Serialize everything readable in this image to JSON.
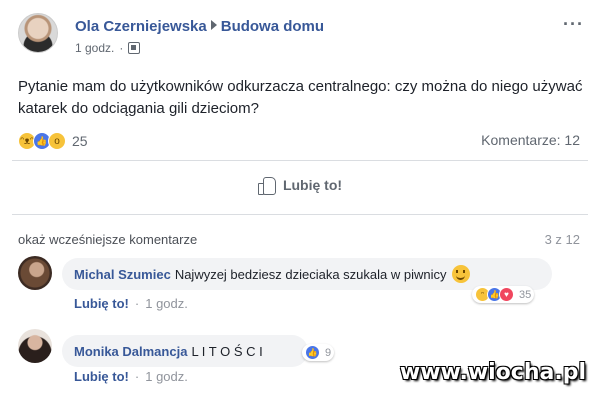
{
  "post": {
    "author": "Ola Czerniejewska",
    "group": "Budowa domu",
    "time": "1 godz.",
    "text": "Pytanie mam do użytkowników odkurzacza centralnego: czy można do niego używać katarek do odciągania gili dzieciom?",
    "reaction_count": "25",
    "comments_label": "Komentarze: 12",
    "like_action": "Lubię to!"
  },
  "comments_section": {
    "previous_label": "okaż wcześniejsze komentarze",
    "page_count": "3 z 12",
    "comments": [
      {
        "author": "Michal Szumiec",
        "text": "Najwyzej bedziesz dzieciaka szukala w piwnicy",
        "like_label": "Lubię to!",
        "separator": "·",
        "time": "1 godz.",
        "reaction_count": "35"
      },
      {
        "author": "Monika Dalmancja",
        "text": "L I T O Ś C I",
        "like_label": "Lubię to!",
        "separator": "·",
        "time": "1 godz.",
        "reaction_count": "9"
      }
    ]
  },
  "watermark": "www.wiocha.pl",
  "colors": {
    "link": "#385898",
    "text": "#1d2129",
    "muted": "#606770",
    "bubble": "#f2f3f5",
    "like_blue": "#4a76e8",
    "haha_yellow": "#f7c33a",
    "love_red": "#f0465e"
  },
  "icons": [
    "more-icon",
    "globe-icon",
    "haha-icon",
    "like-icon",
    "wow-icon",
    "thumb-up-icon",
    "smile-icon",
    "love-icon"
  ]
}
